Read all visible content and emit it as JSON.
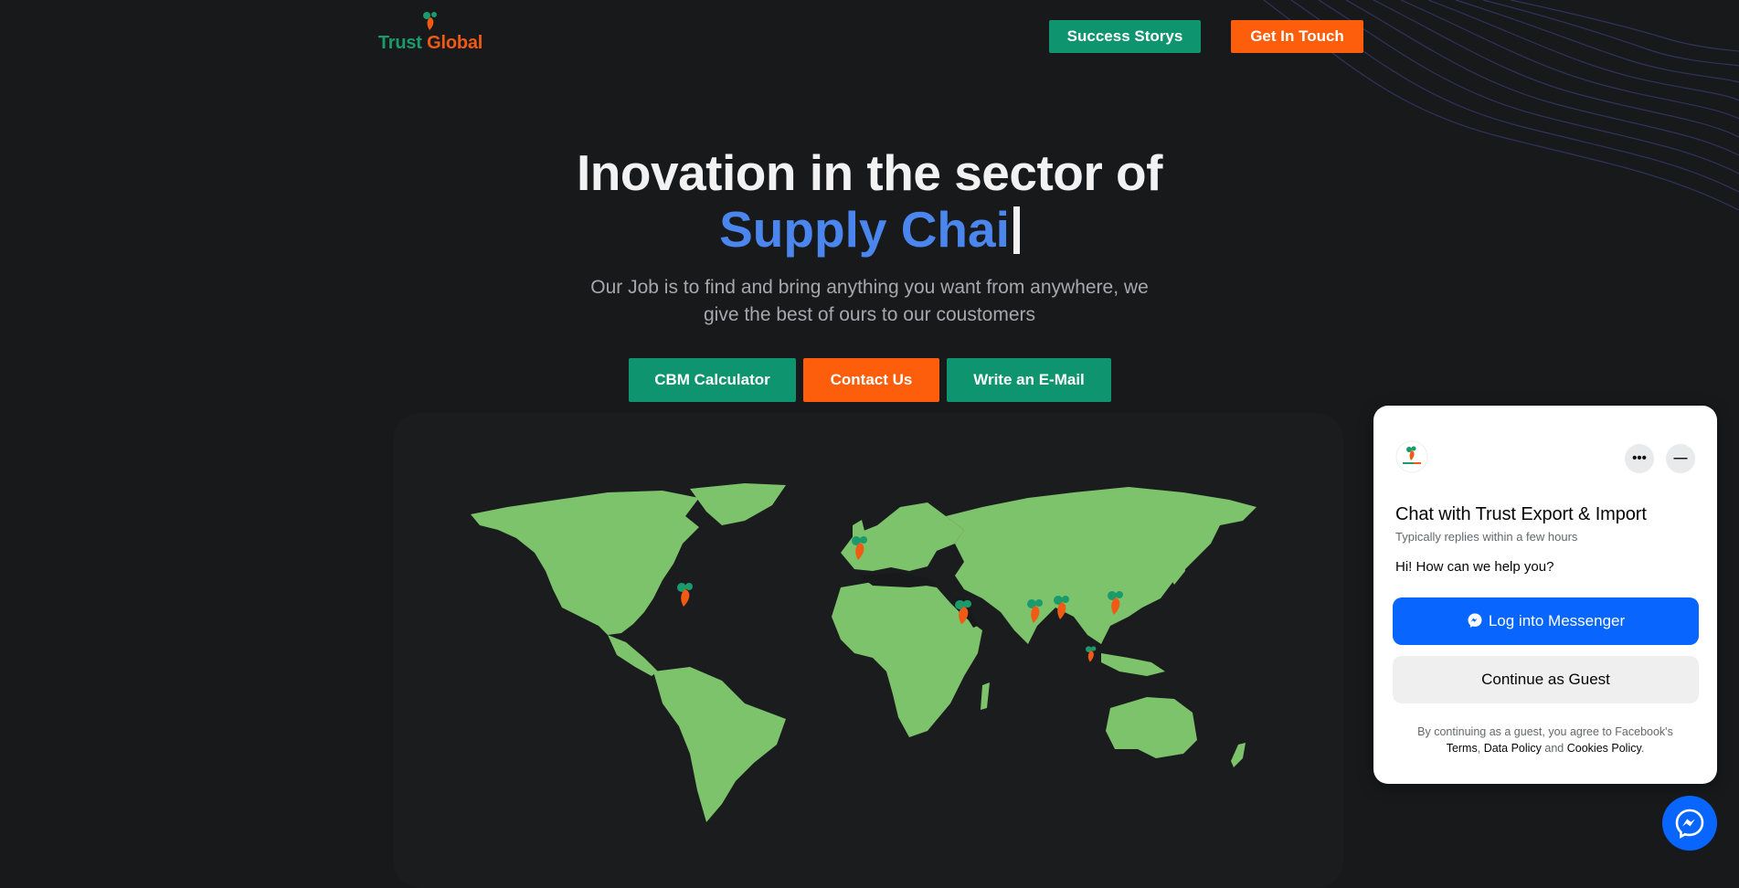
{
  "brand": {
    "name_part1": "Trust",
    "name_part2": "Global",
    "green": "#1b9a6b",
    "orange": "#f05a14"
  },
  "header": {
    "success_label": "Success Storys",
    "contact_label": "Get In Touch"
  },
  "hero": {
    "title": "Inovation in the sector of",
    "accent": "Supply Chai",
    "subtitle": "Our Job is to find and bring anything you want from anywhere, we give the best of ours to our coustomers",
    "accent_color": "#4b86ee"
  },
  "cta": {
    "calculator": "CBM Calculator",
    "contact": "Contact Us",
    "email": "Write an E-Mail"
  },
  "map": {
    "land_color": "#7dc36b",
    "pin_icon": "location-pin-icon",
    "pin_count": 8
  },
  "chat": {
    "title": "Chat with Trust Export & Import",
    "reply_time": "Typically replies within a few hours",
    "greeting": "Hi! How can we help you?",
    "login_label": "Log into Messenger",
    "guest_label": "Continue as Guest",
    "legal_prefix": "By continuing as a guest, you agree to Facebook's",
    "terms": "Terms",
    "comma": ",",
    "data_policy": "Data Policy",
    "and": "and",
    "cookies": "Cookies Policy",
    "period": ".",
    "more_icon": "more-options-icon",
    "minimize_icon": "minimize-icon",
    "messenger_color": "#0866ff"
  }
}
